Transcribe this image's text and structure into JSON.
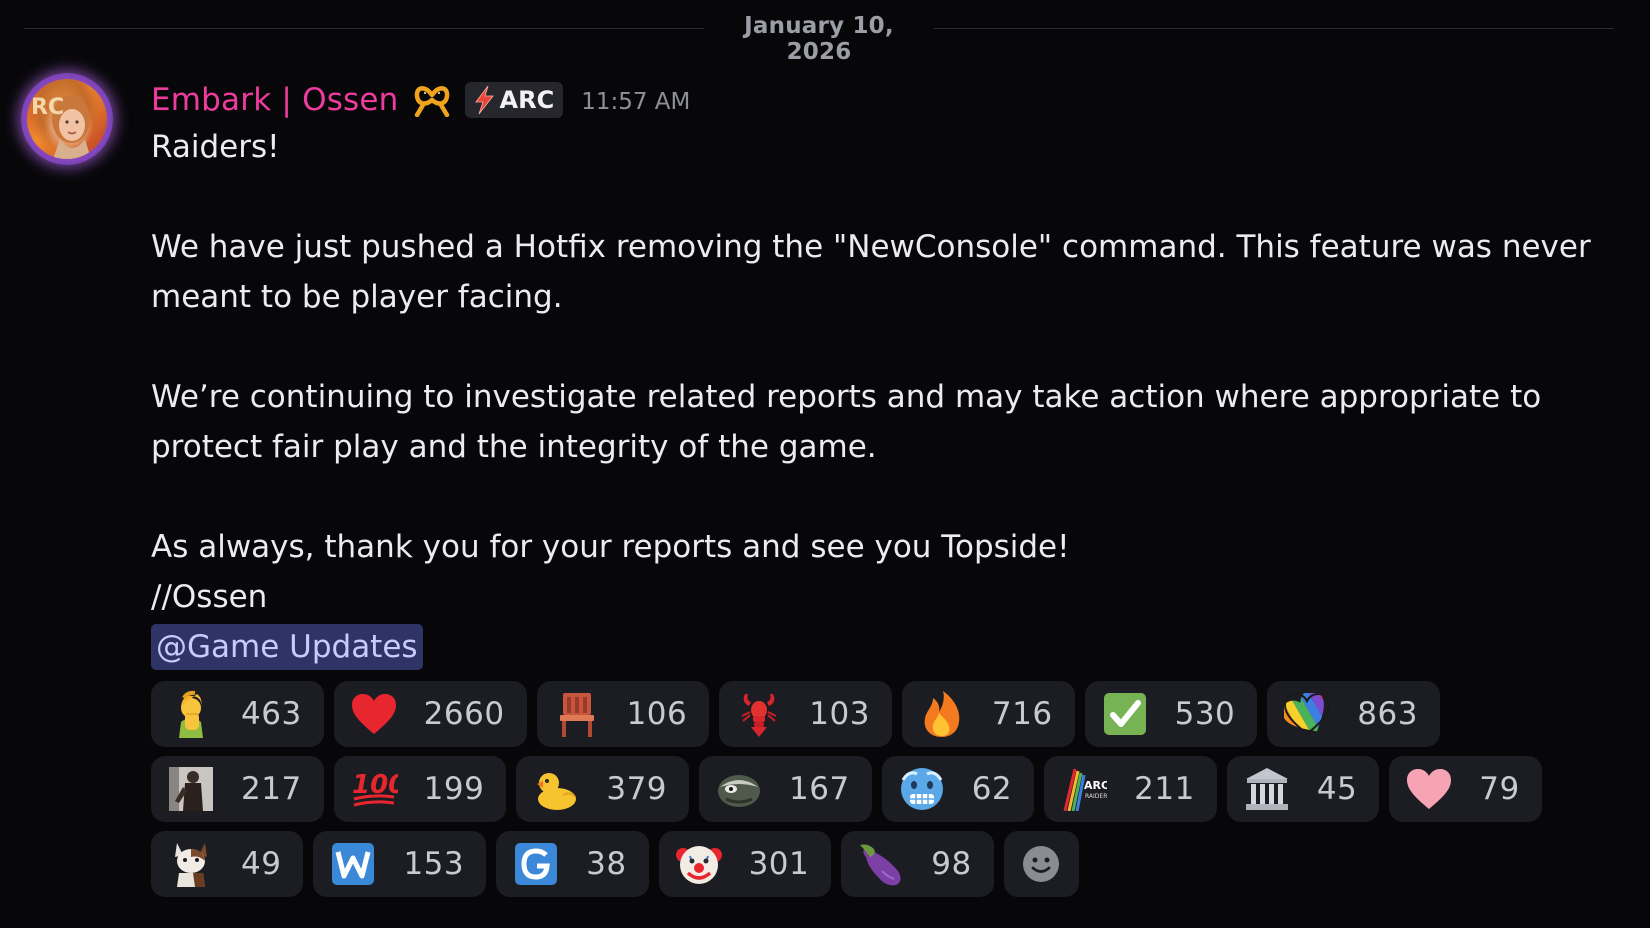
{
  "divider": {
    "date": "January 10, 2026"
  },
  "message": {
    "author": "Embark | Ossen",
    "author_color": "#ee3c9e",
    "author_icon": "pretzel-icon",
    "tag": {
      "icon": "lightning-bolt-icon",
      "label": "ARC"
    },
    "timestamp": "11:57 AM",
    "avatar_letters": "RC",
    "lines": [
      "Raiders!",
      "",
      "We have just pushed a Hotfix removing the \"NewConsole\" command. This feature was never",
      "meant to be player facing.",
      "",
      "We’re continuing to investigate related reports and may take action where appropriate to",
      "protect fair play and the integrity of the game.",
      "",
      "As always, thank you for your reports and see you Topside!",
      "//Ossen"
    ],
    "mention": "@Game Updates",
    "mention_color": "#2f3467"
  },
  "reactions": [
    [
      {
        "icon": "person-facepalm-icon",
        "count": "463"
      },
      {
        "icon": "red-heart-icon",
        "count": "2660"
      },
      {
        "icon": "chair-icon",
        "count": "106"
      },
      {
        "icon": "lobster-icon",
        "count": "103"
      },
      {
        "icon": "fire-icon",
        "count": "716"
      },
      {
        "icon": "check-mark-icon",
        "count": "530"
      },
      {
        "icon": "rainbow-heart-icon",
        "count": "863"
      }
    ],
    [
      {
        "icon": "custom-figure-icon",
        "count": "217"
      },
      {
        "icon": "hundred-points-icon",
        "count": "199"
      },
      {
        "icon": "duck-icon",
        "count": "379"
      },
      {
        "icon": "custom-creature-icon",
        "count": "167"
      },
      {
        "icon": "cold-face-icon",
        "count": "62"
      },
      {
        "icon": "arc-raiders-logo-icon",
        "count": "211"
      },
      {
        "icon": "classical-building-icon",
        "count": "45"
      },
      {
        "icon": "pink-heart-icon",
        "count": "79"
      }
    ],
    [
      {
        "icon": "cat-icon",
        "count": "49"
      },
      {
        "icon": "letter-w-icon",
        "count": "153"
      },
      {
        "icon": "letter-g-icon",
        "count": "38"
      },
      {
        "icon": "clown-face-icon",
        "count": "301"
      },
      {
        "icon": "eggplant-icon",
        "count": "98"
      }
    ]
  ],
  "add_reaction_icon": "add-reaction-smiley-icon"
}
